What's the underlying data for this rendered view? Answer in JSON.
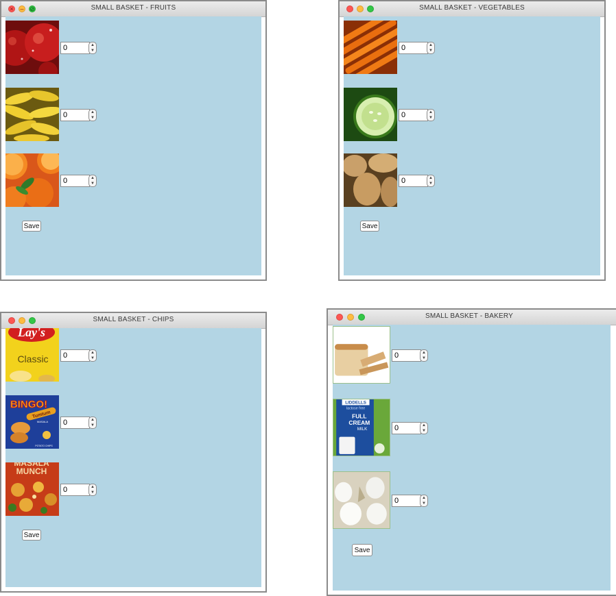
{
  "windows": {
    "fruits": {
      "title": "SMALL BASKET - FRUITS",
      "items": [
        {
          "name": "apple",
          "value": "0"
        },
        {
          "name": "banana",
          "value": "0"
        },
        {
          "name": "orange",
          "value": "0"
        }
      ],
      "save_label": "Save"
    },
    "vegetables": {
      "title": "SMALL BASKET - VEGETABLES",
      "items": [
        {
          "name": "carrot",
          "value": "0"
        },
        {
          "name": "cucumber",
          "value": "0"
        },
        {
          "name": "potato",
          "value": "0"
        }
      ],
      "save_label": "Save"
    },
    "chips": {
      "title": "SMALL BASKET - CHIPS",
      "items": [
        {
          "name": "lays-classic",
          "value": "0",
          "pack_text": [
            "Lay's",
            "Classic"
          ]
        },
        {
          "name": "bingo",
          "value": "0",
          "pack_text": [
            "BINGO!",
            "Tumtum",
            "MASALA",
            "POTATO CHIPS"
          ]
        },
        {
          "name": "masala-munch",
          "value": "0",
          "pack_text": [
            "MASALA",
            "MUNCH"
          ]
        }
      ],
      "save_label": "Save"
    },
    "bakery": {
      "title": "SMALL BASKET - BAKERY",
      "items": [
        {
          "name": "bread",
          "value": "0"
        },
        {
          "name": "milk",
          "value": "0",
          "pack_text": [
            "LIDDELLS",
            "lactose free",
            "FULL",
            "CREAM",
            "MILK"
          ]
        },
        {
          "name": "eggs",
          "value": "0"
        }
      ],
      "save_label": "Save"
    }
  },
  "icons": {
    "close": "close-icon",
    "minimize": "minimize-icon",
    "zoom": "zoom-icon",
    "stepper_up": "chevron-up-icon",
    "stepper_down": "chevron-down-icon"
  },
  "colors": {
    "content_bg": "#b3d5e4",
    "close": "#fc5753",
    "minimize": "#fdbc40",
    "zoom": "#33c748"
  }
}
